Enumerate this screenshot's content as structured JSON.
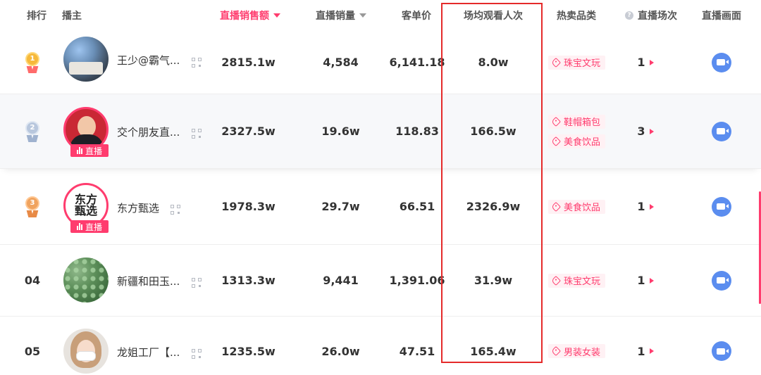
{
  "header": {
    "rank": "排行",
    "anchor": "播主",
    "sales_amount": "直播销售额",
    "sales_volume": "直播销量",
    "unit_price": "客单价",
    "avg_views": "场均观看人次",
    "hot_category": "热卖品类",
    "help_icon": "?",
    "live_sessions": "直播场次",
    "live_screen": "直播画面"
  },
  "live_badge_label": "直播",
  "rows": [
    {
      "rank": "1",
      "name": "王少@霸气...",
      "sales_amount": "2815.1w",
      "sales_volume": "4,584",
      "unit_price": "6,141.18",
      "avg_views": "8.0w",
      "tags": [
        "珠宝文玩"
      ],
      "sessions": "1"
    },
    {
      "rank": "2",
      "name": "交个朋友直...",
      "sales_amount": "2327.5w",
      "sales_volume": "19.6w",
      "unit_price": "118.83",
      "avg_views": "166.5w",
      "tags": [
        "鞋帽箱包",
        "美食饮品"
      ],
      "sessions": "3"
    },
    {
      "rank": "3",
      "name": "东方甄选",
      "avatar_text_1": "东方",
      "avatar_text_2": "甄选",
      "sales_amount": "1978.3w",
      "sales_volume": "29.7w",
      "unit_price": "66.51",
      "avg_views": "2326.9w",
      "tags": [
        "美食饮品"
      ],
      "sessions": "1"
    },
    {
      "rank": "04",
      "name": "新疆和田玉...",
      "sales_amount": "1313.3w",
      "sales_volume": "9,441",
      "unit_price": "1,391.06",
      "avg_views": "31.9w",
      "tags": [
        "珠宝文玩"
      ],
      "sessions": "1"
    },
    {
      "rank": "05",
      "name": "龙姐工厂【...",
      "sales_amount": "1235.5w",
      "sales_volume": "26.0w",
      "unit_price": "47.51",
      "avg_views": "165.4w",
      "tags": [
        "男装女装"
      ],
      "sessions": "1"
    }
  ],
  "colors": {
    "accent": "#ff3c6e",
    "highlight_box": "#e52a2a",
    "video_button": "#5b8def"
  }
}
